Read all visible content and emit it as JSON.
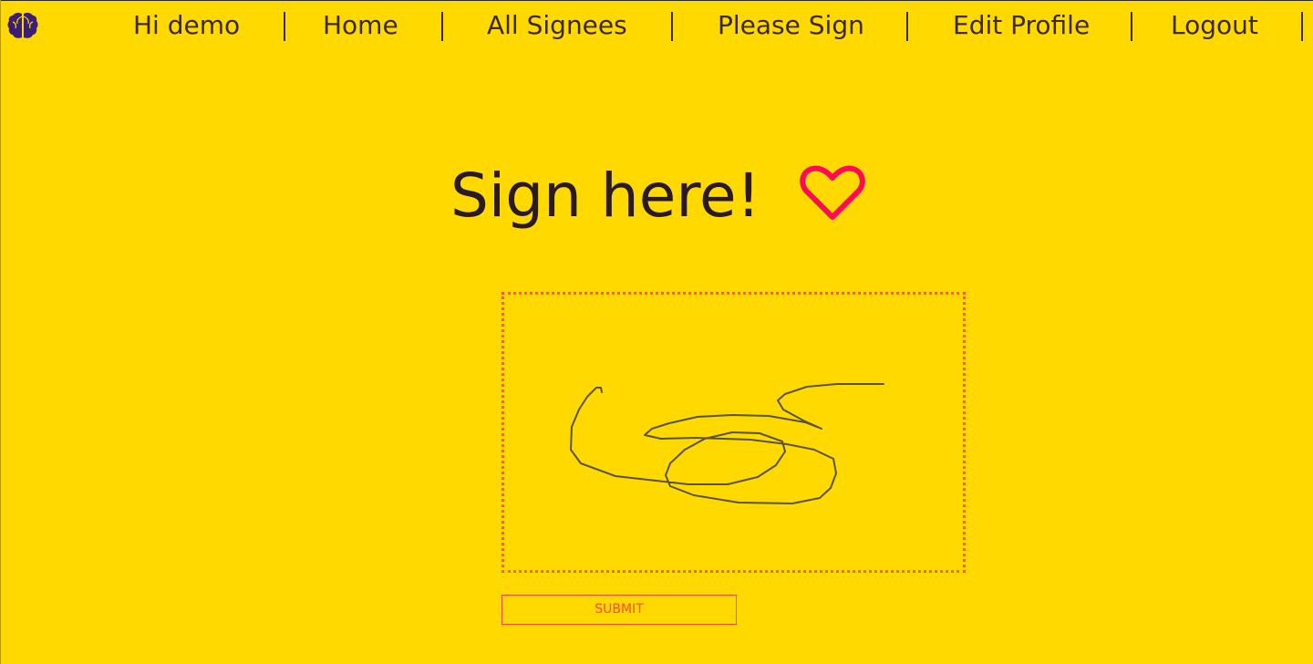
{
  "nav": {
    "greeting": "Hi demo",
    "items": [
      {
        "label": "Home"
      },
      {
        "label": "All Signees"
      },
      {
        "label": "Please Sign"
      },
      {
        "label": "Edit Profile"
      },
      {
        "label": "Logout"
      }
    ],
    "logo_icon": "brain-icon"
  },
  "main": {
    "heading": "Sign here!",
    "heart_icon": "heart-icon",
    "submit_label": "SUBMIT"
  },
  "colors": {
    "background": "#FFD900",
    "accent": "#FF0A54",
    "pad_border": "#FF5A3C",
    "text": "#2A1A24",
    "logo": "#3A1E7A"
  }
}
